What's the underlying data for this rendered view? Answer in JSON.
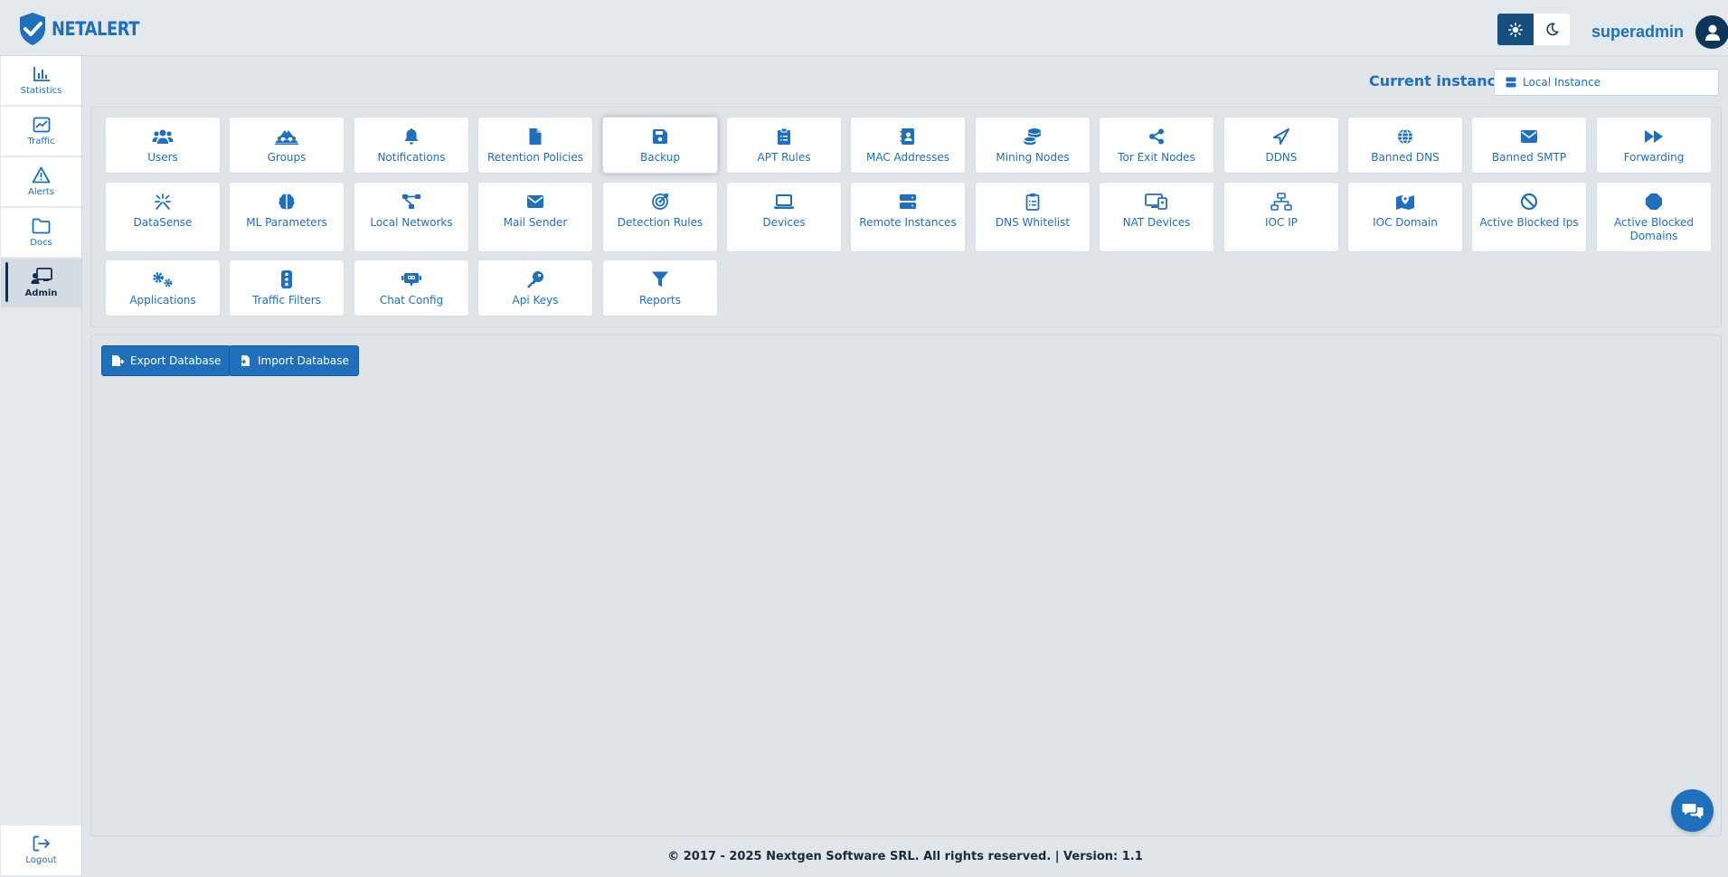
{
  "app": {
    "logo_text": "NETALERT"
  },
  "header": {
    "username": "superadmin",
    "theme_light_icon": "sun-icon",
    "theme_dark_icon": "moon-icon",
    "avatar_icon": "user-icon"
  },
  "sidebar": {
    "items": [
      {
        "label": "Statistics",
        "icon": "bar-chart-icon"
      },
      {
        "label": "Traffic",
        "icon": "line-chart-icon"
      },
      {
        "label": "Alerts",
        "icon": "warning-icon"
      },
      {
        "label": "Docs",
        "icon": "folder-icon"
      },
      {
        "label": "Admin",
        "icon": "admin-board-icon",
        "active": true
      }
    ],
    "logout_label": "Logout"
  },
  "instance": {
    "label": "Current instance:",
    "selected": "Local Instance"
  },
  "tiles": [
    {
      "label": "Users",
      "icon": "users-icon"
    },
    {
      "label": "Groups",
      "icon": "groups-icon"
    },
    {
      "label": "Notifications",
      "icon": "bell-icon"
    },
    {
      "label": "Retention Policies",
      "icon": "file-icon"
    },
    {
      "label": "Backup",
      "icon": "floppy-icon",
      "selected": true
    },
    {
      "label": "APT Rules",
      "icon": "clipboard-icon"
    },
    {
      "label": "MAC Addresses",
      "icon": "address-book-icon"
    },
    {
      "label": "Mining Nodes",
      "icon": "coins-icon"
    },
    {
      "label": "Tor Exit Nodes",
      "icon": "share-icon"
    },
    {
      "label": "DDNS",
      "icon": "location-arrow-icon"
    },
    {
      "label": "Banned DNS",
      "icon": "globe-icon"
    },
    {
      "label": "Banned SMTP",
      "icon": "envelope-icon"
    },
    {
      "label": "Forwarding",
      "icon": "forward-icon"
    },
    {
      "label": "DataSense",
      "icon": "sparkle-icon"
    },
    {
      "label": "ML Parameters",
      "icon": "brain-icon"
    },
    {
      "label": "Local Networks",
      "icon": "network-icon"
    },
    {
      "label": "Mail Sender",
      "icon": "envelope-icon"
    },
    {
      "label": "Detection Rules",
      "icon": "target-icon"
    },
    {
      "label": "Devices",
      "icon": "laptop-icon"
    },
    {
      "label": "Remote Instances",
      "icon": "server-icon"
    },
    {
      "label": "DNS Whitelist",
      "icon": "clipboard-list-icon"
    },
    {
      "label": "NAT Devices",
      "icon": "devices-icon"
    },
    {
      "label": "IOC IP",
      "icon": "sitemap-icon"
    },
    {
      "label": "IOC Domain",
      "icon": "map-marker-icon"
    },
    {
      "label": "Active Blocked Ips",
      "icon": "ban-icon"
    },
    {
      "label": "Active Blocked Domains",
      "icon": "octagon-icon"
    },
    {
      "label": "Applications",
      "icon": "cogs-icon"
    },
    {
      "label": "Traffic Filters",
      "icon": "traffic-light-icon"
    },
    {
      "label": "Chat Config",
      "icon": "robot-icon"
    },
    {
      "label": "Api Keys",
      "icon": "key-icon"
    },
    {
      "label": "Reports",
      "icon": "filter-icon"
    }
  ],
  "actions": {
    "export_label": "Export Database",
    "import_label": "Import Database"
  },
  "footer": {
    "text": "© 2017 - 2025 Nextgen Software SRL. All rights reserved. | Version: 1.1"
  },
  "colors": {
    "accent": "#1f6fba",
    "dark": "#10355a",
    "background": "#e0e5ea"
  }
}
